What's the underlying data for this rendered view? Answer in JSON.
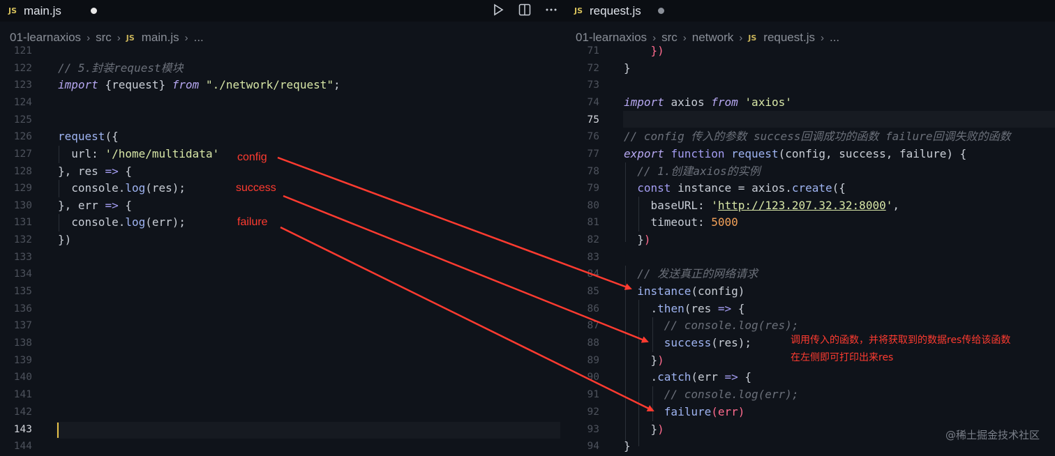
{
  "left": {
    "tab": {
      "badge": "JS",
      "name": "main.js"
    },
    "breadcrumb": {
      "folder": "01-learnaxios",
      "sub": "src",
      "badge": "JS",
      "file": "main.js",
      "more": "..."
    },
    "active_line": "143"
  },
  "right": {
    "tab": {
      "badge": "JS",
      "name": "request.js"
    },
    "breadcrumb": {
      "folder": "01-learnaxios",
      "sub": "src",
      "sub2": "network",
      "badge": "JS",
      "file": "request.js",
      "more": "..."
    }
  },
  "annotations": {
    "config": "config",
    "success": "success",
    "failure": "failure",
    "note_line1": "调用传入的函数，并将获取到的数据res传给该函数",
    "note_line2": "在左侧即可打印出来res"
  },
  "watermark": "@稀土掘金技术社区",
  "colors": {
    "annotation_red": "#ff3b30",
    "cursor": "#e7c34a",
    "string": "#d8e7a7",
    "keyword": "#b7a8f2"
  }
}
